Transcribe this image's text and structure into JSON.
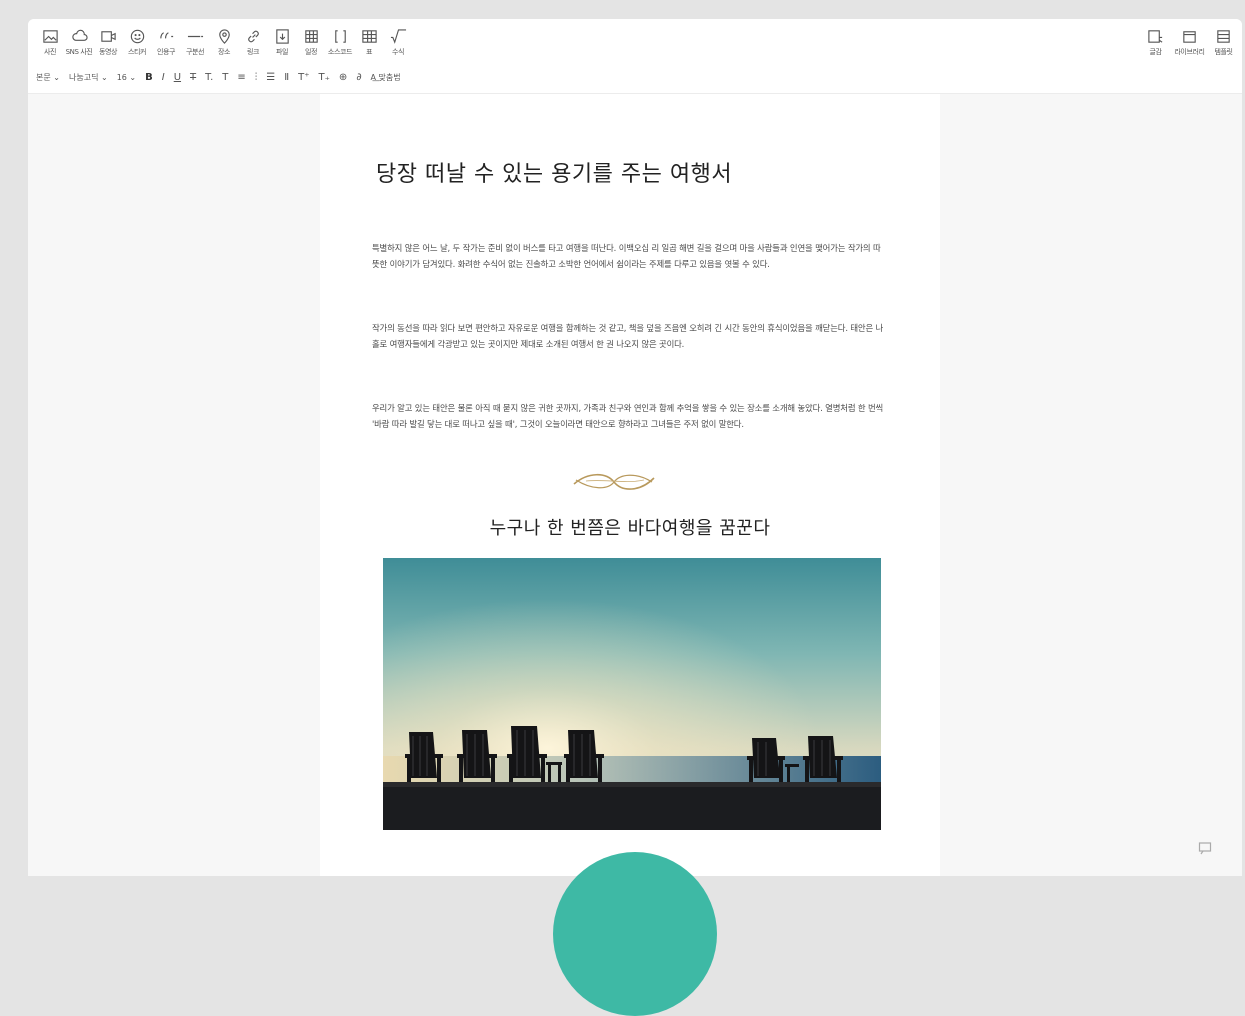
{
  "toolbar": {
    "insert_items": [
      {
        "label": "사진",
        "icon": "photo-icon"
      },
      {
        "label": "SNS 사진",
        "icon": "sns-photo-icon"
      },
      {
        "label": "동영상",
        "icon": "video-icon"
      },
      {
        "label": "스티커",
        "icon": "sticker-icon"
      },
      {
        "label": "인용구",
        "icon": "quote-icon"
      },
      {
        "label": "구분선",
        "icon": "divider-icon"
      },
      {
        "label": "장소",
        "icon": "place-icon"
      },
      {
        "label": "링크",
        "icon": "link-icon"
      },
      {
        "label": "파일",
        "icon": "file-icon"
      },
      {
        "label": "일정",
        "icon": "schedule-icon"
      },
      {
        "label": "소스코드",
        "icon": "source-code-icon"
      },
      {
        "label": "표",
        "icon": "table-icon"
      },
      {
        "label": "수식",
        "icon": "formula-icon"
      }
    ],
    "right_items": [
      {
        "label": "글감",
        "icon": "material-icon"
      },
      {
        "label": "라이브러리",
        "icon": "library-icon"
      },
      {
        "label": "템플릿",
        "icon": "template-icon"
      }
    ],
    "format": {
      "paragraph_style": "본문",
      "font": "나눔고딕",
      "font_size": "16",
      "spell_check": "맞춤법"
    }
  },
  "document": {
    "title": "당장 떠날 수 있는 용기를 주는 여행서",
    "paragraphs": [
      "특별하지 않은 어느 날, 두 작가는 준비 없이 버스를 타고 여행을 떠난다. 이백오십 리 일곱 해변 길을 걸으며 마을 사람들과 인연을 맺어가는 작가의 따뜻한 이야기가 담겨있다. 화려한 수식어 없는 진솔하고 소박한 언어에서 쉼이라는 주제를 다루고 있음을 엿볼 수 있다.",
      "작가의 동선을 따라 읽다 보면 편안하고 자유로운 여행을 함께하는 것 같고, 책을 덮을 즈음엔 오히려 긴 시간 동안의 휴식이었음을 깨닫는다. 태안은 나 홀로 여행자들에게 각광받고 있는 곳이지만 제대로 소개된 여행서 한 권 나오지 않은 곳이다.",
      "우리가 알고 있는 태안은 물론 아직 때 묻지 않은 귀한 곳까지, 가족과 친구와 연인과 함께 추억을 쌓을 수 있는 장소를 소개해 놓았다. 열병처럼 한 번씩 '바람 따라 발길 닿는 대로 떠나고 싶을 때', 그것이 오늘이라면 태안으로 향하라고 그녀들은 주저 없이 말한다."
    ],
    "subtitle": "누구나 한 번쯤은 바다여행을 꿈꾼다",
    "image": "beach-chairs-at-sunset"
  },
  "colors": {
    "accent_teal": "#3eb9a5",
    "ornament_gold": "#b8995c"
  }
}
